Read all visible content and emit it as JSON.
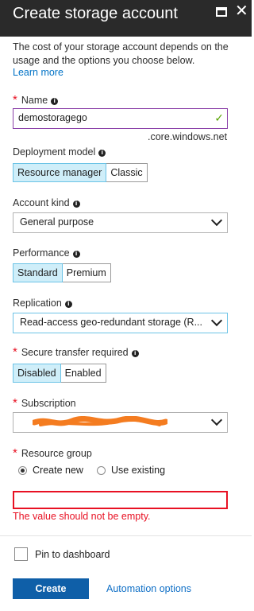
{
  "window": {
    "title": "Create storage account",
    "maximize_icon": "maximize-icon",
    "close_icon": "close-icon"
  },
  "intro": {
    "text": "The cost of your storage account depends on the usage and the options you choose below.",
    "learn_more": "Learn more"
  },
  "name": {
    "label": "Name",
    "value": "demostoragego",
    "suffix": ".core.windows.net"
  },
  "deployment_model": {
    "label": "Deployment model",
    "options": [
      "Resource manager",
      "Classic"
    ],
    "selected": "Resource manager"
  },
  "account_kind": {
    "label": "Account kind",
    "value": "General purpose"
  },
  "performance": {
    "label": "Performance",
    "options": [
      "Standard",
      "Premium"
    ],
    "selected": "Standard"
  },
  "replication": {
    "label": "Replication",
    "value": "Read-access geo-redundant storage (R..."
  },
  "secure_transfer": {
    "label": "Secure transfer required",
    "options": [
      "Disabled",
      "Enabled"
    ],
    "selected": "Disabled"
  },
  "subscription": {
    "label": "Subscription",
    "value": ""
  },
  "resource_group": {
    "label": "Resource group",
    "options": [
      "Create new",
      "Use existing"
    ],
    "selected": "Create new",
    "value": "",
    "error": "The value should not be empty."
  },
  "footer": {
    "pin_label": "Pin to dashboard",
    "create_label": "Create",
    "automation_label": "Automation options"
  },
  "colors": {
    "title_bar": "#2a2a2a",
    "selected_toggle": "#cfeef9",
    "error": "#e81123",
    "primary_button": "#0f5fa8",
    "link": "#0072c6",
    "valid_check": "#57a300",
    "scribble": "#f47c20"
  }
}
